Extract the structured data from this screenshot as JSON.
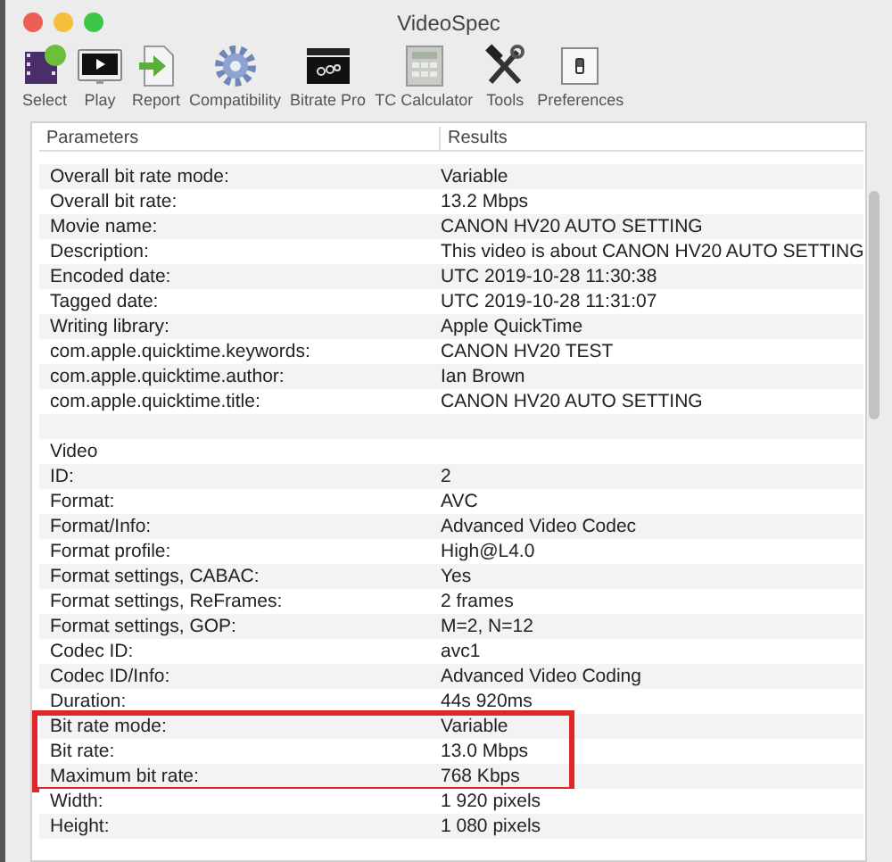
{
  "window": {
    "title": "VideoSpec"
  },
  "toolbar": [
    {
      "label": "Select"
    },
    {
      "label": "Play"
    },
    {
      "label": "Report"
    },
    {
      "label": "Compatibility"
    },
    {
      "label": "Bitrate Pro"
    },
    {
      "label": "TC Calculator"
    },
    {
      "label": "Tools"
    },
    {
      "label": "Preferences"
    }
  ],
  "table": {
    "columns": [
      "Parameters",
      "Results"
    ],
    "sections": [
      {
        "rows": [
          {
            "parameter": "Overall bit rate mode:",
            "result": "Variable",
            "highlighted": false
          },
          {
            "parameter": "Overall bit rate:",
            "result": "13.2 Mbps",
            "highlighted": false
          },
          {
            "parameter": "Movie name:",
            "result": "CANON HV20 AUTO SETTING",
            "highlighted": false
          },
          {
            "parameter": "Description:",
            "result": "This video is about CANON HV20 AUTO SETTING",
            "highlighted": false
          },
          {
            "parameter": "Encoded date:",
            "result": "UTC 2019-10-28 11:30:38",
            "highlighted": false
          },
          {
            "parameter": "Tagged date:",
            "result": "UTC 2019-10-28 11:31:07",
            "highlighted": false
          },
          {
            "parameter": "Writing library:",
            "result": "Apple QuickTime",
            "highlighted": false
          },
          {
            "parameter": "com.apple.quicktime.keywords:",
            "result": "CANON HV20 TEST",
            "highlighted": false
          },
          {
            "parameter": "com.apple.quicktime.author:",
            "result": "Ian Brown",
            "highlighted": false
          },
          {
            "parameter": "com.apple.quicktime.title:",
            "result": "CANON HV20 AUTO SETTING",
            "highlighted": false
          }
        ]
      },
      {
        "title": "Video",
        "rows": [
          {
            "parameter": "ID:",
            "result": "2",
            "highlighted": false
          },
          {
            "parameter": "Format:",
            "result": "AVC",
            "highlighted": false
          },
          {
            "parameter": "Format/Info:",
            "result": "Advanced Video Codec",
            "highlighted": false
          },
          {
            "parameter": "Format profile:",
            "result": "High@L4.0",
            "highlighted": false
          },
          {
            "parameter": "Format settings, CABAC:",
            "result": "Yes",
            "highlighted": false
          },
          {
            "parameter": "Format settings, ReFrames:",
            "result": "2 frames",
            "highlighted": false
          },
          {
            "parameter": "Format settings, GOP:",
            "result": "M=2, N=12",
            "highlighted": false
          },
          {
            "parameter": "Codec ID:",
            "result": "avc1",
            "highlighted": false
          },
          {
            "parameter": "Codec ID/Info:",
            "result": "Advanced Video Coding",
            "highlighted": false
          },
          {
            "parameter": "Duration:",
            "result": "44s 920ms",
            "highlighted": false
          },
          {
            "parameter": "Bit rate mode:",
            "result": "Variable",
            "highlighted": true
          },
          {
            "parameter": "Bit rate:",
            "result": "13.0 Mbps",
            "highlighted": true
          },
          {
            "parameter": "Maximum bit rate:",
            "result": "768 Kbps",
            "highlighted": true
          },
          {
            "parameter": "Width:",
            "result": "1 920 pixels",
            "highlighted": false
          },
          {
            "parameter": "Height:",
            "result": "1 080 pixels",
            "highlighted": false
          }
        ]
      }
    ]
  }
}
